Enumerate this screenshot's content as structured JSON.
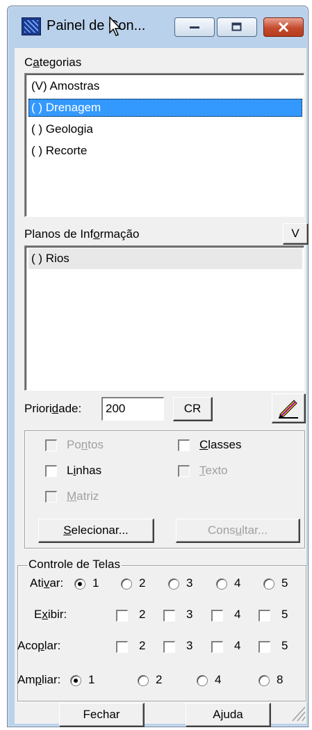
{
  "window": {
    "title": "Painel de Con...",
    "icon": "app-grid-icon",
    "controls": [
      "minimize-icon",
      "maximize-icon",
      "close-icon"
    ]
  },
  "categorias": {
    "label": "Categorias",
    "items": [
      "(V) Amostras",
      "( ) Drenagem",
      "( ) Geologia",
      "( ) Recorte"
    ],
    "selected": "( ) Drenagem"
  },
  "planos": {
    "label": "Planos de Informação",
    "v_button": "V",
    "items": [
      "( ) Rios"
    ]
  },
  "prioridade": {
    "label": "Prioridade:",
    "value": "200",
    "cr_button": "CR",
    "color_icon": "pencil-color-icon"
  },
  "representacoes": {
    "pontos": "Pontos",
    "classes": "Classes",
    "linhas": "Linhas",
    "texto": "Texto",
    "matriz": "Matriz"
  },
  "actions": {
    "selecionar": "Selecionar...",
    "consultar": "Consultar..."
  },
  "controle": {
    "legend": "Controle de Telas",
    "ativar_label": "Ativar:",
    "ativar_options": [
      "1",
      "2",
      "3",
      "4",
      "5"
    ],
    "ativar_selected": "1",
    "exibir_label": "Exibir:",
    "exibir_options": [
      "2",
      "3",
      "4",
      "5"
    ],
    "acoplar_label": "Acoplar:",
    "acoplar_options": [
      "2",
      "3",
      "4",
      "5"
    ],
    "ampliar_label": "Ampliar:",
    "ampliar_options": [
      "1",
      "2",
      "4",
      "8"
    ],
    "ampliar_selected": "1"
  },
  "footer": {
    "fechar": "Fechar",
    "ajuda": "Ajuda"
  }
}
